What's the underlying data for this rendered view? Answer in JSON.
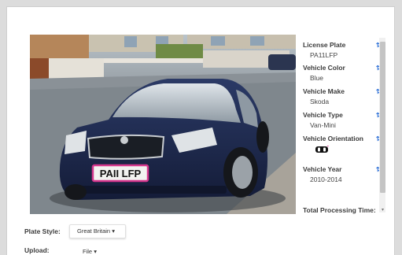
{
  "results": {
    "fields": [
      {
        "label": "License Plate",
        "value": "PA11LFP"
      },
      {
        "label": "Vehicle Color",
        "value": "Blue"
      },
      {
        "label": "Vehicle Make",
        "value": "Skoda"
      },
      {
        "label": "Vehicle Type",
        "value": "Van-Mini"
      },
      {
        "label": "Vehicle Orientation",
        "value": "",
        "icon": "car-front-icon"
      },
      {
        "label": "Vehicle Year",
        "value": "2010-2014"
      }
    ],
    "sort_glyph": "⇅",
    "total_label": "Total Processing Time:"
  },
  "photo": {
    "plate_text": "PA11LFP",
    "plate_display": "PAII LFP",
    "car_color": "#1e2a4f"
  },
  "controls": {
    "plate_style_label": "Plate Style:",
    "plate_style_value": "Great Britain",
    "upload_label": "Upload:",
    "upload_value": "File"
  },
  "colors": {
    "accent": "#2b6ed6",
    "plate_border": "#d6368d"
  }
}
